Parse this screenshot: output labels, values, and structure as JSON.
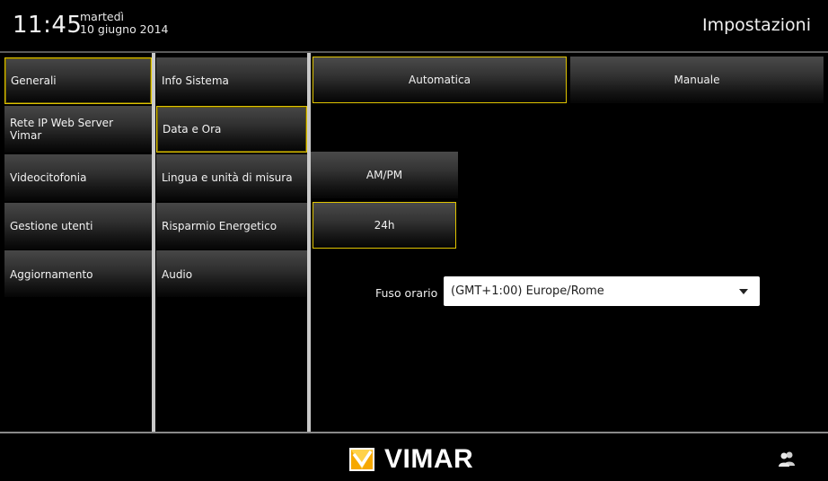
{
  "header": {
    "time": "11:45",
    "weekday": "martedì",
    "date": "10 giugno 2014",
    "title": "Impostazioni"
  },
  "menu_main": {
    "items": [
      {
        "label": "Generali",
        "selected": true
      },
      {
        "label": "Rete IP Web Server Vimar",
        "selected": false
      },
      {
        "label": "Videocitofonia",
        "selected": false
      },
      {
        "label": "Gestione utenti",
        "selected": false
      },
      {
        "label": "Aggiornamento",
        "selected": false
      }
    ]
  },
  "menu_sub": {
    "items": [
      {
        "label": "Info Sistema",
        "selected": false
      },
      {
        "label": "Data e Ora",
        "selected": true
      },
      {
        "label": "Lingua e unità di misura",
        "selected": false
      },
      {
        "label": "Risparmio Energetico",
        "selected": false
      },
      {
        "label": "Audio",
        "selected": false
      }
    ]
  },
  "panel": {
    "mode_tabs": [
      {
        "label": "Automatica",
        "selected": true
      },
      {
        "label": "Manuale",
        "selected": false
      }
    ],
    "time_format": [
      {
        "label": "AM/PM",
        "selected": false
      },
      {
        "label": "24h",
        "selected": true
      }
    ],
    "timezone": {
      "label": "Fuso orario",
      "value": "(GMT+1:00) Europe/Rome"
    }
  },
  "footer": {
    "brand": "VIMAR",
    "icons": [
      "vimar-logo-icon",
      "users-icon"
    ]
  },
  "colors": {
    "selection_border": "#e0c400",
    "background": "#000000"
  }
}
